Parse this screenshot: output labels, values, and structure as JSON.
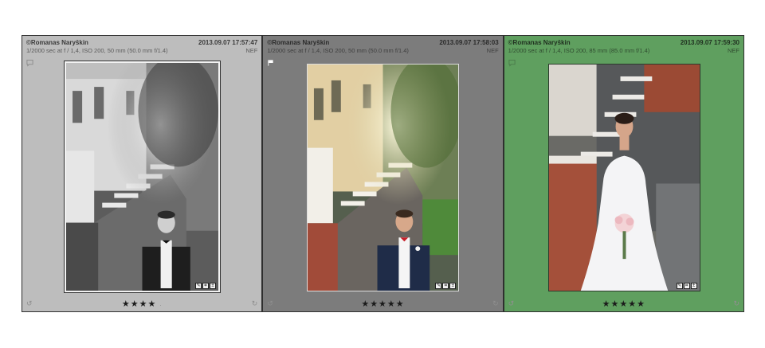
{
  "cells": [
    {
      "author": "©Romanas Naryškin",
      "datetime": "2013.09.07 17:57:47",
      "exposure": "1/2000 sec at f / 1,4, ISO 200, 50 mm (50.0 mm f/1.4)",
      "format": "NEF",
      "stars": "★★★★",
      "star_dot": "·",
      "flag": "comment-flag-icon"
    },
    {
      "author": "©Romanas Naryškin",
      "datetime": "2013.09.07 17:58:03",
      "exposure": "1/2000 sec at f / 1,4, ISO 200, 50 mm (50.0 mm f/1.4)",
      "format": "NEF",
      "stars": "★★★★★",
      "flag": "pick-flag-icon"
    },
    {
      "author": "©Romanas Naryškin",
      "datetime": "2013.09.07 17:59:30",
      "exposure": "1/2000 sec at f / 1,4, ISO 200, 85 mm (85.0 mm f/1.4)",
      "format": "NEF",
      "stars": "★★★★★",
      "flag": "comment-flag-icon"
    }
  ],
  "colors": {
    "cell1_bg": "#bdbdbd",
    "cell2_bg": "#7c7c7c",
    "cell3_label_green": "#5f9f5f"
  }
}
